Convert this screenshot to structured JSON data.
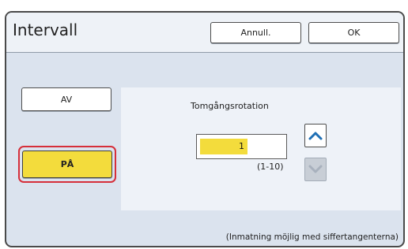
{
  "header": {
    "title": "Intervall",
    "cancel_label": "Annull.",
    "ok_label": "OK"
  },
  "mode": {
    "off_label": "AV",
    "on_label": "PÅ",
    "selected": "PÅ"
  },
  "idle_rotation": {
    "label": "Tomgångsrotation",
    "value": "1",
    "range": "(1-10)",
    "up_icon": "chevron-up-icon",
    "down_icon": "chevron-down-icon"
  },
  "footer": {
    "hint": "(Inmatning möjlig med siffertangenterna)"
  },
  "colors": {
    "selected_fill": "#f3dc3c",
    "selection_outline": "#d62f3a",
    "arrow_active": "#1f6fb5",
    "arrow_disabled": "#a8b1bd"
  }
}
